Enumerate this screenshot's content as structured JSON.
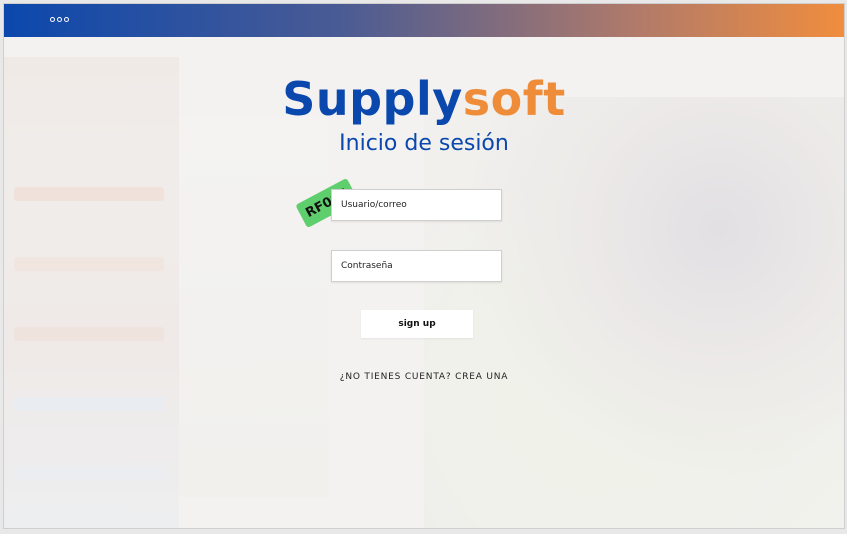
{
  "header": {
    "menu_icon": "three-dots-icon"
  },
  "brand": {
    "part1": "Supply",
    "part2": "soft"
  },
  "title": "Inicio de sesión",
  "badge": "RF005",
  "form": {
    "username_placeholder": "Usuario/correo",
    "password_placeholder": "Contraseña",
    "submit_label": "sign up",
    "register_link": "¿NO TIENES CUENTA? CREA UNA"
  },
  "colors": {
    "blue": "#0b48ad",
    "orange": "#ef8c3a",
    "badge_green": "#5fcf6d"
  }
}
